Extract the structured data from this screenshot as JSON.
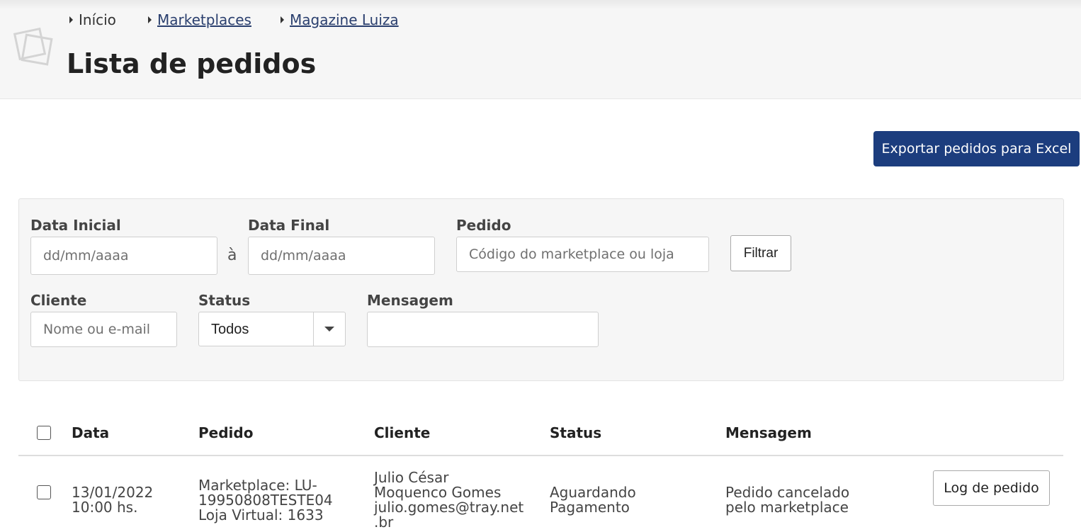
{
  "breadcrumb": {
    "items": [
      {
        "label": "Início"
      },
      {
        "label": "Marketplaces"
      },
      {
        "label": "Magazine Luiza"
      }
    ]
  },
  "page": {
    "title": "Lista de pedidos"
  },
  "toolbar": {
    "export_label": "Exportar pedidos para Excel"
  },
  "filters": {
    "data_inicial": {
      "label": "Data Inicial",
      "placeholder": "dd/mm/aaaa",
      "value": ""
    },
    "range_separator": "à",
    "data_final": {
      "label": "Data Final",
      "placeholder": "dd/mm/aaaa",
      "value": ""
    },
    "pedido": {
      "label": "Pedido",
      "placeholder": "Código do marketplace ou loja",
      "value": ""
    },
    "filtrar_label": "Filtrar",
    "cliente": {
      "label": "Cliente",
      "placeholder": "Nome ou e-mail",
      "value": ""
    },
    "status": {
      "label": "Status",
      "selected": "Todos"
    },
    "mensagem": {
      "label": "Mensagem",
      "placeholder": "",
      "value": ""
    }
  },
  "table": {
    "columns": [
      "Data",
      "Pedido",
      "Cliente",
      "Status",
      "Mensagem"
    ],
    "rows": [
      {
        "date": "13/01/2022",
        "time": "10:00 hs.",
        "pedido_line1": "Marketplace: LU-",
        "pedido_line2": "19950808TESTE04",
        "pedido_line3": "Loja Virtual: 1633",
        "cliente_line1": "Julio César",
        "cliente_line2": "Moquenco Gomes",
        "cliente_line3": "julio.gomes@tray.net",
        "cliente_line4": ".br",
        "status_line1": "Aguardando",
        "status_line2": "Pagamento",
        "mensagem_line1": "Pedido cancelado",
        "mensagem_line2": "pelo marketplace",
        "action_label": "Log de pedido"
      }
    ]
  },
  "colors": {
    "primary": "#1c3d7e",
    "header_bg": "#f6f6f6",
    "link": "#2a3f6e"
  },
  "icons": {
    "logo": "stacked-squares-logo-icon",
    "breadcrumb_marker": "triangle-right-icon",
    "select_caret": "chevron-down-icon"
  }
}
